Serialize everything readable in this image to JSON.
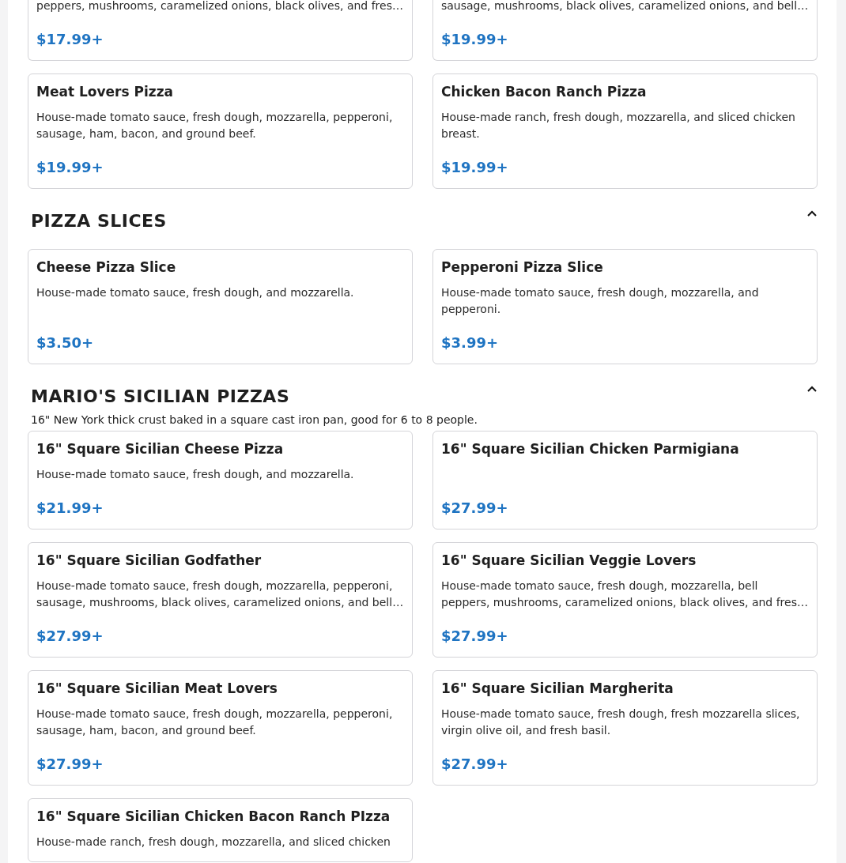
{
  "sections": [
    {
      "cards": [
        {
          "description": "peppers, mushrooms, caramelized onions, black olives, and fres…",
          "price": "$17.99+"
        },
        {
          "description": "sausage, mushrooms, black olives, caramelized onions, and bell…",
          "price": "$19.99+"
        },
        {
          "name": "Meat Lovers Pizza",
          "description": "House-made tomato sauce, fresh dough, mozzarella, pepperoni, sausage, ham, bacon, and ground beef.",
          "price": "$19.99+"
        },
        {
          "name": "Chicken Bacon Ranch Pizza",
          "description": "House-made ranch, fresh dough, mozzarella, and sliced chicken breast.",
          "price": "$19.99+"
        }
      ]
    },
    {
      "title": "PIZZA SLICES",
      "cards": [
        {
          "name": "Cheese Pizza Slice",
          "description": "House-made tomato sauce, fresh dough, and mozzarella.",
          "price": "$3.50+"
        },
        {
          "name": "Pepperoni Pizza Slice",
          "description": "House-made tomato sauce, fresh dough, mozzarella, and pepperoni.",
          "price": "$3.99+"
        }
      ]
    },
    {
      "title": "MARIO'S SICILIAN PIZZAS",
      "subtitle": "16\" New York thick crust baked in a square cast iron pan, good for 6 to 8 people.",
      "cards": [
        {
          "name": "16\" Square Sicilian Cheese Pizza",
          "description": "House-made tomato sauce, fresh dough, and mozzarella.",
          "price": "$21.99+"
        },
        {
          "name": "16\" Square Sicilian Chicken Parmigiana",
          "price": "$27.99+"
        },
        {
          "name": "16\" Square Sicilian Godfather",
          "description": "House-made tomato sauce, fresh dough, mozzarella, pepperoni, sausage, mushrooms, black olives, caramelized onions, and bell…",
          "price": "$27.99+"
        },
        {
          "name": "16\" Square Sicilian Veggie Lovers",
          "description": "House-made tomato sauce, fresh dough, mozzarella, bell peppers, mushrooms, caramelized onions, black olives, and fres…",
          "price": "$27.99+"
        },
        {
          "name": "16\" Square Sicilian Meat Lovers",
          "description": "House-made tomato sauce, fresh dough, mozzarella, pepperoni, sausage, ham, bacon, and ground beef.",
          "price": "$27.99+"
        },
        {
          "name": "16\" Square Sicilian Margherita",
          "description": "House-made tomato sauce, fresh dough, fresh mozzarella slices, virgin olive oil, and fresh basil.",
          "price": "$27.99+"
        },
        {
          "name": "16\" Square Sicilian Chicken Bacon Ranch PIzza",
          "description": "House-made ranch, fresh dough, mozzarella, and sliced chicken"
        }
      ]
    }
  ]
}
